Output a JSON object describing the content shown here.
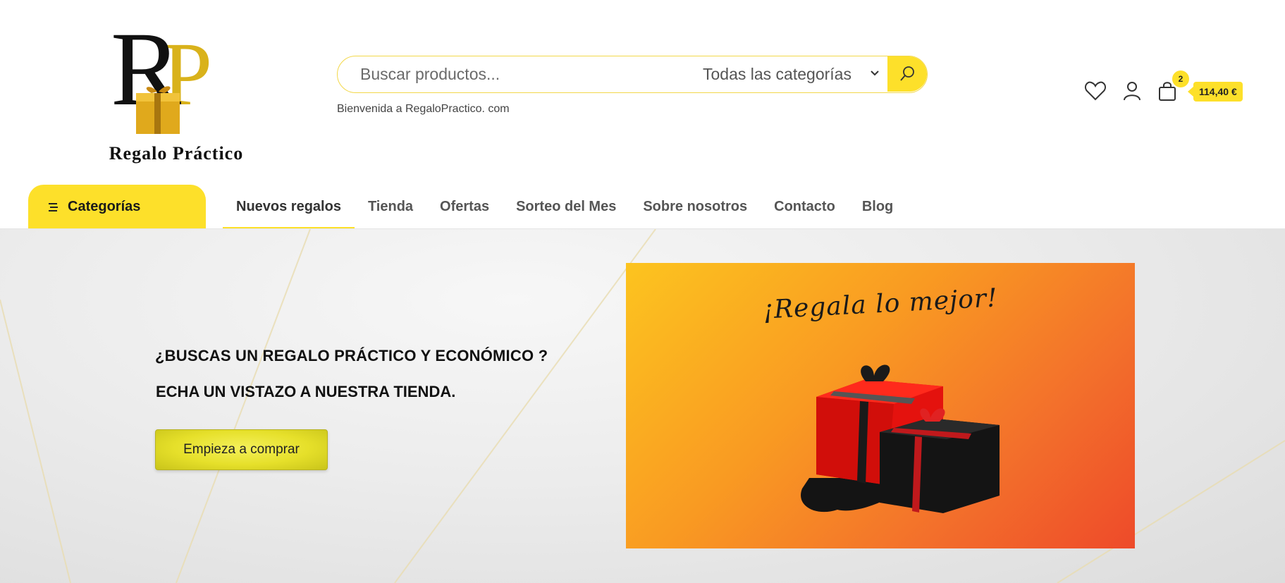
{
  "brand": {
    "name": "Regalo Práctico",
    "monogram": "RP",
    "accent_color": "#fde02a"
  },
  "search": {
    "placeholder": "Buscar productos...",
    "category_selected": "Todas las categorías",
    "button_icon": "search-icon"
  },
  "welcome_text": "Bienvenida a RegaloPractico. com",
  "header_icons": {
    "wishlist_icon": "heart-icon",
    "account_icon": "user-icon",
    "cart_icon": "shopping-bag-icon",
    "cart_count": "2",
    "cart_total": "114,40 €"
  },
  "nav": {
    "categories_label": "Categorías",
    "categories_icon": "menu-lines-icon",
    "items": [
      {
        "label": "Nuevos regalos",
        "active": true
      },
      {
        "label": "Tienda",
        "active": false
      },
      {
        "label": "Ofertas",
        "active": false
      },
      {
        "label": "Sorteo del Mes",
        "active": false
      },
      {
        "label": "Sobre nosotros",
        "active": false
      },
      {
        "label": "Contacto",
        "active": false
      },
      {
        "label": "Blog",
        "active": false
      }
    ]
  },
  "hero": {
    "line1": "¿BUSCAS UN REGALO PRÁCTICO Y ECONÓMICO ?",
    "line2": "ECHA UN VISTAZO A NUESTRA TIENDA.",
    "cta_label": "Empieza a comprar",
    "promo_title": "¡Regala lo mejor!"
  }
}
